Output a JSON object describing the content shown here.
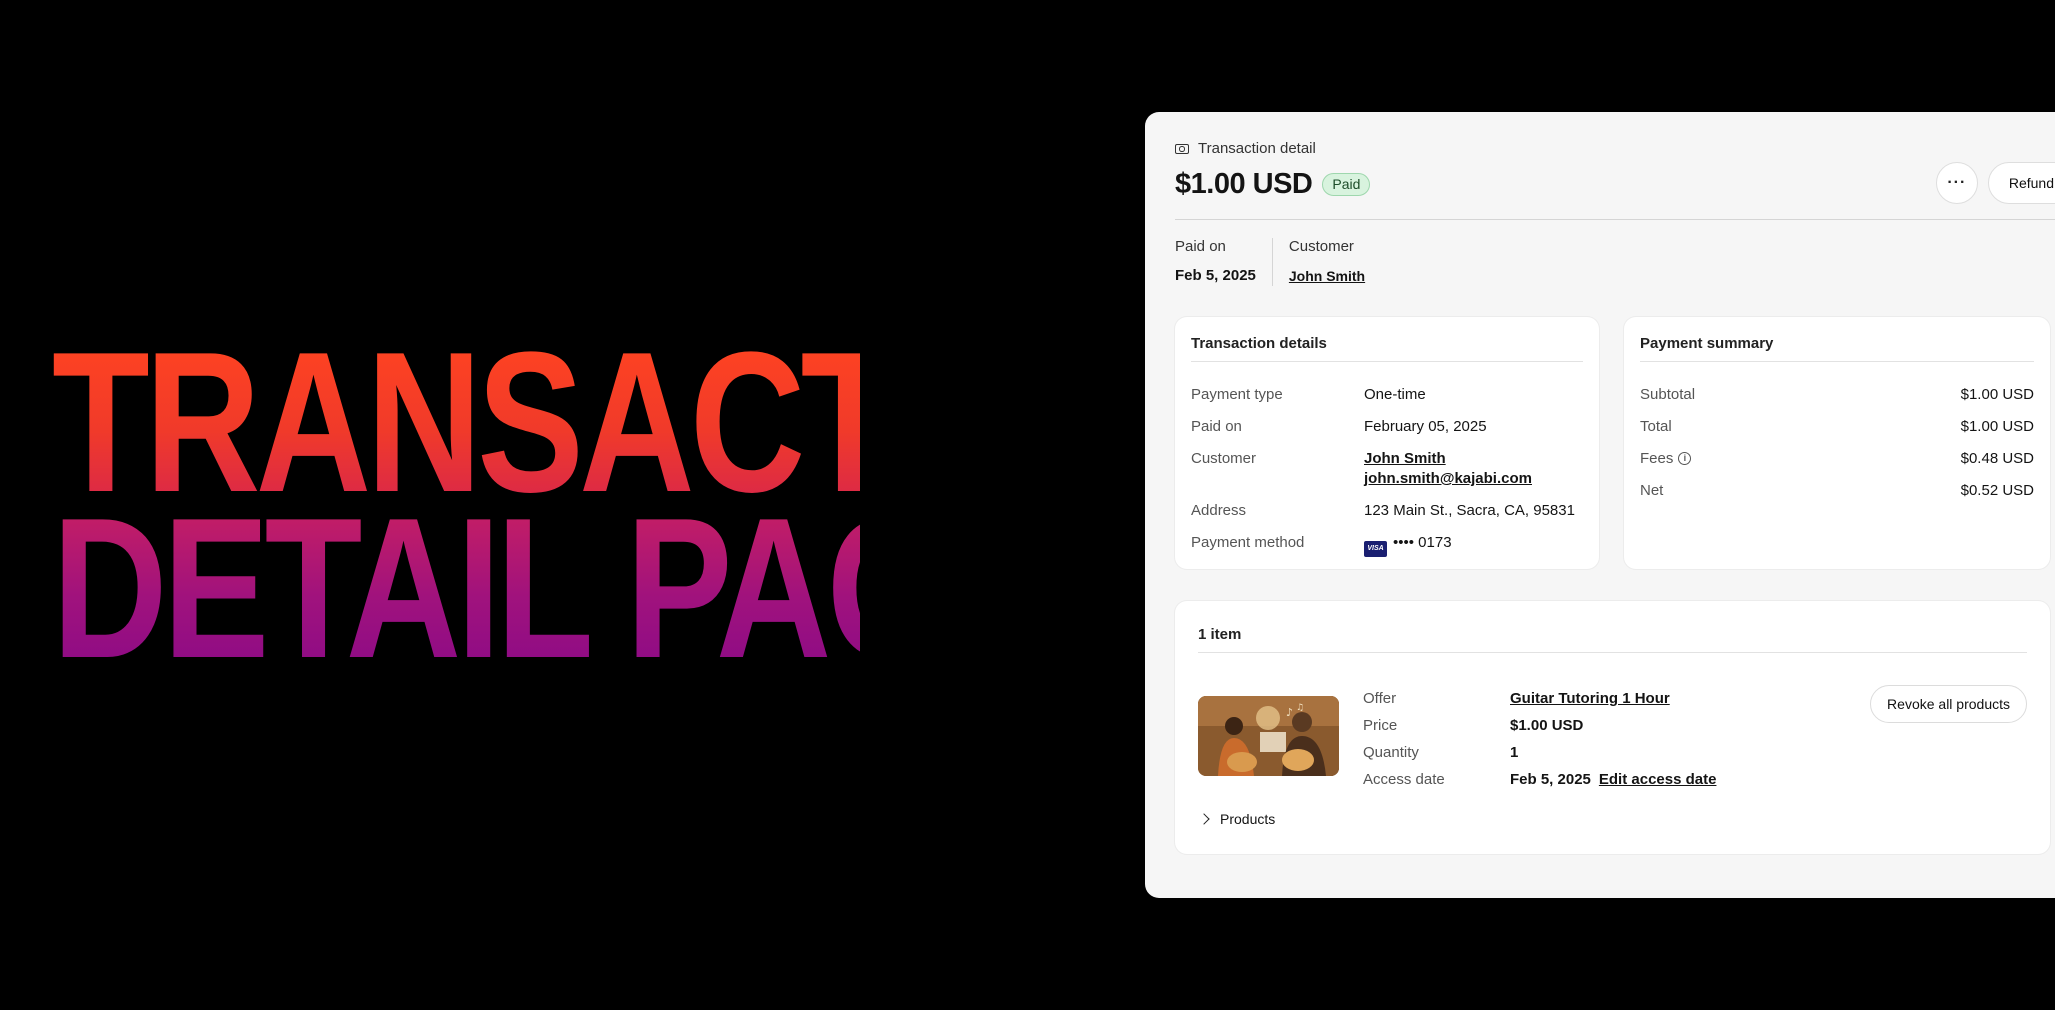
{
  "hero": {
    "line1": "TRANSACTION",
    "line2": "DETAIL PAGE"
  },
  "header": {
    "breadcrumb": "Transaction detail",
    "breadcrumb_icon": "cash-icon",
    "amount": "$1.00 USD",
    "status": "Paid",
    "more_label": "···",
    "refund_label": "Refund"
  },
  "meta": {
    "paid_on_label": "Paid on",
    "paid_on_value": "Feb 5, 2025",
    "customer_label": "Customer",
    "customer_value": "John Smith"
  },
  "transaction_details": {
    "title": "Transaction details",
    "payment_type_label": "Payment type",
    "payment_type_value": "One-time",
    "paid_on_label": "Paid on",
    "paid_on_value": "February 05, 2025",
    "customer_label": "Customer",
    "customer_name": "John Smith",
    "customer_email": "john.smith@kajabi.com",
    "address_label": "Address",
    "address_value": "123 Main St., Sacra, CA, 95831",
    "payment_method_label": "Payment method",
    "card_brand": "VISA",
    "card_number": "•••• 0173"
  },
  "payment_summary": {
    "title": "Payment summary",
    "subtotal_label": "Subtotal",
    "subtotal_value": "$1.00 USD",
    "total_label": "Total",
    "total_value": "$1.00 USD",
    "fees_label": "Fees",
    "fees_value": "$0.48 USD",
    "net_label": "Net",
    "net_value": "$0.52 USD"
  },
  "items": {
    "title": "1 item",
    "offer_label": "Offer",
    "offer_value": "Guitar Tutoring 1 Hour",
    "price_label": "Price",
    "price_value": "$1.00 USD",
    "quantity_label": "Quantity",
    "quantity_value": "1",
    "access_label": "Access date",
    "access_value": "Feb 5, 2025",
    "edit_access_label": "Edit access date",
    "revoke_label": "Revoke all products",
    "products_label": "Products"
  },
  "colors": {
    "hero_top": "#ff4321",
    "hero_bottom": "#8d0b86",
    "paid_badge_bg": "#d8f3de",
    "visa_blue": "#1a1f71"
  }
}
